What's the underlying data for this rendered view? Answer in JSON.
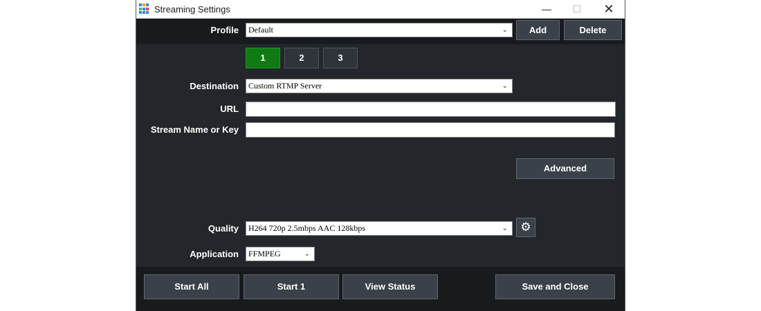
{
  "window": {
    "title": "Streaming Settings",
    "controls": {
      "minimize": "—",
      "maximize": "☐",
      "close": "✕"
    },
    "icon_colors": [
      "#3b7fd9",
      "#f0a020",
      "#3b7fd9",
      "#3bbf4a",
      "#3b7fd9",
      "#e04040",
      "#3b7fd9",
      "#3b7fd9",
      "#3b7fd9"
    ]
  },
  "profile": {
    "label": "Profile",
    "value": "Default",
    "add_label": "Add",
    "delete_label": "Delete"
  },
  "tabs": [
    {
      "label": "1",
      "active": true
    },
    {
      "label": "2",
      "active": false
    },
    {
      "label": "3",
      "active": false
    }
  ],
  "destination": {
    "label": "Destination",
    "value": "Custom RTMP Server"
  },
  "url": {
    "label": "URL",
    "value": ""
  },
  "stream_key": {
    "label": "Stream Name or Key",
    "value": ""
  },
  "advanced_label": "Advanced",
  "quality": {
    "label": "Quality",
    "value": "H264 720p 2.5mbps AAC 128kbps"
  },
  "application": {
    "label": "Application",
    "value": "FFMPEG"
  },
  "footer": {
    "start_all": "Start All",
    "start_1": "Start 1",
    "view_status": "View Status",
    "save_close": "Save and Close"
  },
  "colors": {
    "active_tab": "#0f7a12",
    "background": "#23272b",
    "band": "#181b1e"
  }
}
